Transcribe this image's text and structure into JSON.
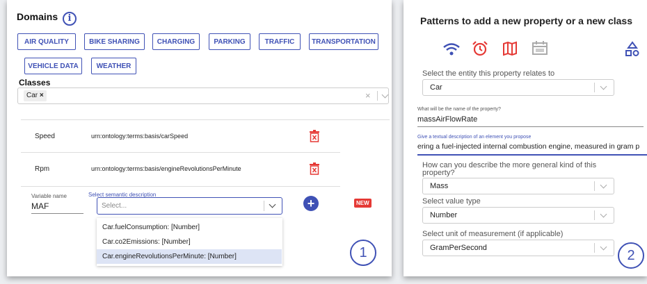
{
  "left": {
    "domains_title": "Domains",
    "info_glyph": "i",
    "chips": [
      "AIR QUALITY",
      "BIKE SHARING",
      "CHARGING",
      "PARKING",
      "TRAFFIC",
      "TRANSPORTATION",
      "VEHICLE DATA",
      "WEATHER"
    ],
    "classes_title": "Classes",
    "class_tag": "Car",
    "tag_remove": "×",
    "clear_glyph": "×",
    "rows": [
      {
        "name": "Speed",
        "uri": "urn:ontology:terms:basis/carSpeed"
      },
      {
        "name": "Rpm",
        "uri": "urn:ontology:terms:basis/engineRevolutionsPerMinute"
      }
    ],
    "variable_label": "Variable name",
    "variable_value": "MAF",
    "semantic_label": "Select semantic description",
    "semantic_placeholder": "Select...",
    "add_glyph": "+",
    "new_badge": "NEW",
    "options": [
      "Car.fuelConsumption: [Number]",
      "Car.co2Emissions: [Number]",
      "Car.engineRevolutionsPerMinute: [Number]"
    ],
    "step_number": "1"
  },
  "right": {
    "title": "Patterns to add a new property or a new class",
    "entity_label": "Select the entity this property relates to",
    "entity_value": "Car",
    "prop_name_label": "What will be the name of the property?",
    "prop_name_value": "massAirFlowRate",
    "desc_label": "Give a textual description of an element you propose",
    "desc_value": "ering a fuel-injected internal combustion engine, measured in gram p",
    "general_label_1": "How can you describe the more general kind of this",
    "general_label_2": "property?",
    "general_value": "Mass",
    "value_type_label": "Select value type",
    "value_type_value": "Number",
    "unit_label": "Select unit of measurement (if applicable)",
    "unit_value": "GramPerSecond",
    "step_number": "2"
  },
  "colors": {
    "accent": "#3f51b5",
    "danger": "#e53935",
    "highlight": "#dde4f5"
  }
}
